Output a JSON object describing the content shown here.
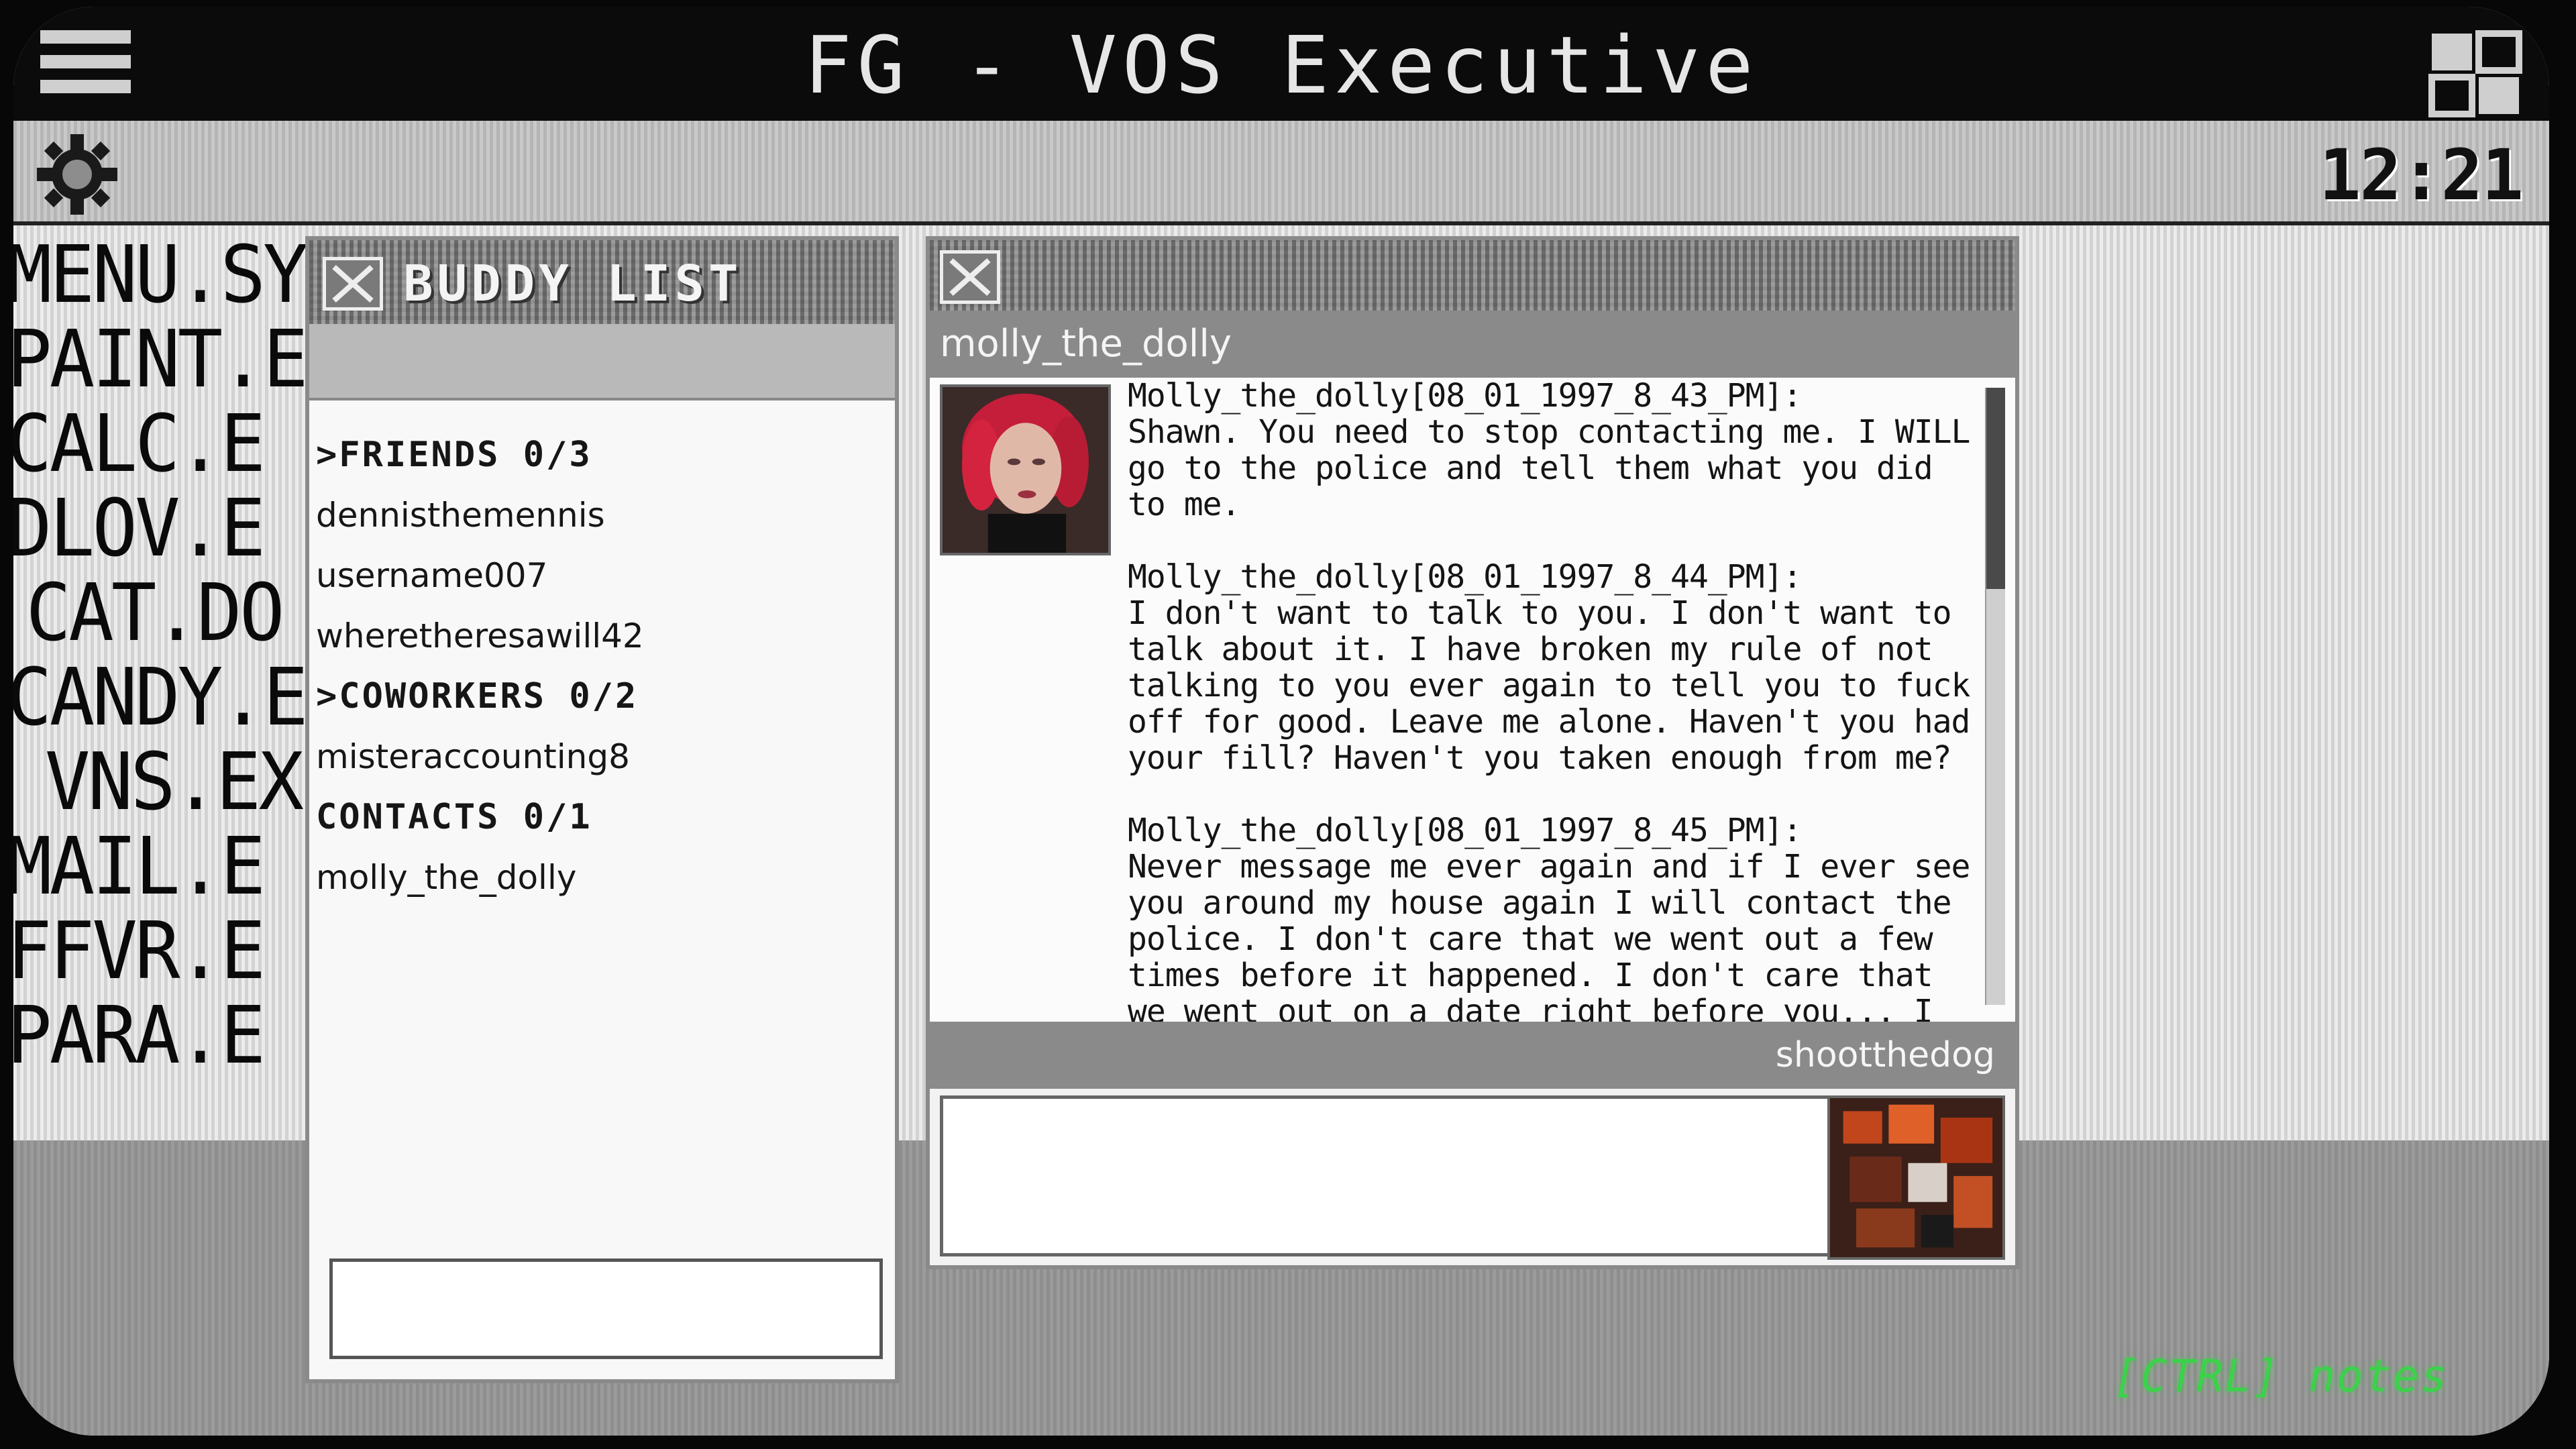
{
  "window": {
    "title": "FG - VOS Executive"
  },
  "statusbar": {
    "clock": "12:21"
  },
  "desktop_files": [
    "MENU.SY",
    "PAINT.E",
    "CALC.E",
    "DLOV.E",
    "CAT.DO",
    "CANDY.E",
    "VNS.EX",
    "MAIL.E",
    "FFVR.E",
    "PARA.E"
  ],
  "buddy_list": {
    "title": "BUDDY LIST",
    "groups": [
      {
        "label": ">FRIENDS 0/3",
        "buddies": [
          "dennisthemennis",
          "username007",
          "wheretheresawill42"
        ]
      },
      {
        "label": ">COWORKERS 0/2",
        "buddies": [
          "misteraccounting8"
        ]
      },
      {
        "label": "CONTACTS 0/1",
        "buddies": [
          "molly_the_dolly"
        ]
      }
    ]
  },
  "chat": {
    "contact": "molly_the_dolly",
    "self": "shootthedog",
    "messages": [
      {
        "header": "Molly_the_dolly[08_01_1997_8_43_PM]:",
        "text": "Shawn. You need to stop contacting me. I WILL go to the police and tell them what you did to me."
      },
      {
        "header": "Molly_the_dolly[08_01_1997_8_44_PM]:",
        "text": "I don't want to talk to you. I don't want to talk about it. I have broken my rule of not talking to you ever again to tell you to fuck off for good. Leave me alone. Haven't you had your fill? Haven't you taken enough from me?"
      },
      {
        "header": "Molly_the_dolly[08_01_1997_8_45_PM]:",
        "text": "Never message me ever again and if I ever see you around my house again I will contact the police. I don't care that we went out a few times before it happened. I don't care that we went out on a date right before you... I am dead serious Shawn."
      }
    ]
  },
  "hint": "[CTRL] notes",
  "colors": {
    "hint": "#3bd24a",
    "titlebar": "#0b0b0b",
    "header_bar": "#8a8a8a"
  }
}
